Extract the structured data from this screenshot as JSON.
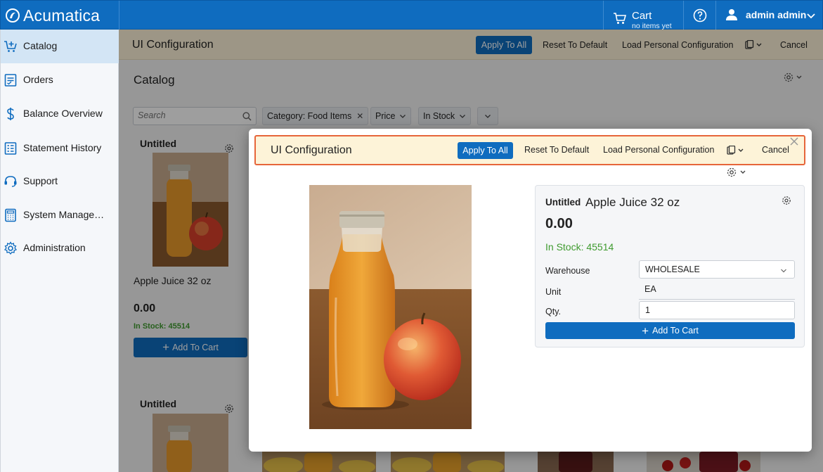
{
  "app": {
    "brand": "Acumatica"
  },
  "header": {
    "cart_title": "Cart",
    "cart_subtitle": "no items yet",
    "user_name": "admin admin"
  },
  "sidebar": {
    "items": [
      {
        "label": "Catalog",
        "icon": "cart-plus-icon",
        "active": true
      },
      {
        "label": "Orders",
        "icon": "orders-icon"
      },
      {
        "label": "Balance Overview",
        "icon": "dollar-icon"
      },
      {
        "label": "Statement History",
        "icon": "statement-icon"
      },
      {
        "label": "Support",
        "icon": "headset-icon"
      },
      {
        "label": "System Manage…",
        "icon": "calculator-icon"
      },
      {
        "label": "Administration",
        "icon": "gear-icon"
      }
    ]
  },
  "config_bar": {
    "title": "UI Configuration",
    "apply_all": "Apply To All",
    "reset_default": "Reset To Default",
    "load_personal": "Load Personal Configuration",
    "cancel": "Cancel"
  },
  "catalog": {
    "title": "Catalog",
    "search_placeholder": "Search",
    "filter_category": "Category: Food Items",
    "filter_price": "Price",
    "filter_stock": "In Stock"
  },
  "cards": [
    {
      "head": "Untitled",
      "name": "Apple Juice 32 oz",
      "price": "0.00",
      "stock": "In Stock: 45514",
      "add_label": "Add To Cart"
    },
    {
      "head": "Untitled"
    }
  ],
  "modal": {
    "config_title": "UI Configuration",
    "apply_all": "Apply To All",
    "reset_default": "Reset To Default",
    "load_personal": "Load Personal Configuration",
    "cancel": "Cancel",
    "product": {
      "head": "Untitled",
      "name": "Apple Juice 32 oz",
      "price": "0.00",
      "stock": "In Stock: 45514",
      "warehouse_label": "Warehouse",
      "warehouse_value": "WHOLESALE",
      "unit_label": "Unit",
      "unit_value": "EA",
      "qty_label": "Qty.",
      "qty_value": "1",
      "add_label": "Add To Cart"
    }
  },
  "colors": {
    "brand_blue": "#0f6cbf",
    "config_bg": "#fdf3d8",
    "highlight_border": "#e6653a",
    "stock_green": "#3f9b2f"
  }
}
